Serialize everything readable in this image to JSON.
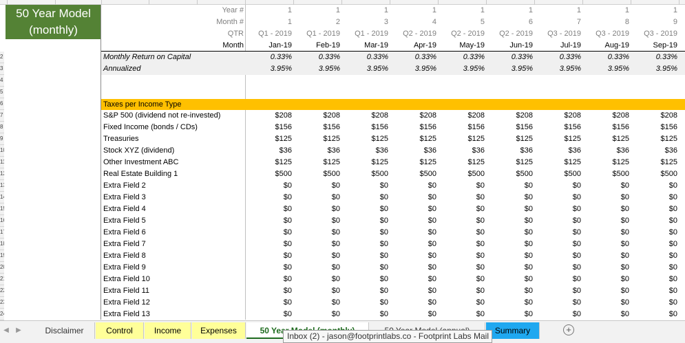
{
  "model_title": "50 Year Model (monthly)",
  "header_labels": {
    "year": "Year #",
    "month": "Month #",
    "qtr": "QTR",
    "month_name": "Month"
  },
  "columns": [
    {
      "year": "1",
      "month": "1",
      "qtr": "Q1 - 2019",
      "month_name": "Jan-19"
    },
    {
      "year": "1",
      "month": "2",
      "qtr": "Q1 - 2019",
      "month_name": "Feb-19"
    },
    {
      "year": "1",
      "month": "3",
      "qtr": "Q1 - 2019",
      "month_name": "Mar-19"
    },
    {
      "year": "1",
      "month": "4",
      "qtr": "Q2 - 2019",
      "month_name": "Apr-19"
    },
    {
      "year": "1",
      "month": "5",
      "qtr": "Q2 - 2019",
      "month_name": "May-19"
    },
    {
      "year": "1",
      "month": "6",
      "qtr": "Q2 - 2019",
      "month_name": "Jun-19"
    },
    {
      "year": "1",
      "month": "7",
      "qtr": "Q3 - 2019",
      "month_name": "Jul-19"
    },
    {
      "year": "1",
      "month": "8",
      "qtr": "Q3 - 2019",
      "month_name": "Aug-19"
    },
    {
      "year": "1",
      "month": "9",
      "qtr": "Q3 - 2019",
      "month_name": "Sep-19"
    }
  ],
  "returns": [
    {
      "label": "Monthly Return on Capital",
      "value": "0.33%"
    },
    {
      "label": "Annualized",
      "value": "3.95%"
    }
  ],
  "taxes_section": {
    "title": "Taxes per Income Type",
    "rows": [
      {
        "label": "S&P 500 (dividend not re-invested)",
        "value": "$208"
      },
      {
        "label": "Fixed Income (bonds / CDs)",
        "value": "$156"
      },
      {
        "label": "Treasuries",
        "value": "$125"
      },
      {
        "label": "Stock XYZ (dividend)",
        "value": "$36"
      },
      {
        "label": "Other Investment ABC",
        "value": "$125"
      },
      {
        "label": "Real Estate Building 1",
        "value": "$500"
      },
      {
        "label": "Extra Field 2",
        "value": "$0"
      },
      {
        "label": "Extra Field 3",
        "value": "$0"
      },
      {
        "label": "Extra Field 4",
        "value": "$0"
      },
      {
        "label": "Extra Field 5",
        "value": "$0"
      },
      {
        "label": "Extra Field 6",
        "value": "$0"
      },
      {
        "label": "Extra Field 7",
        "value": "$0"
      },
      {
        "label": "Extra Field 8",
        "value": "$0"
      },
      {
        "label": "Extra Field 9",
        "value": "$0"
      },
      {
        "label": "Extra Field 10",
        "value": "$0"
      },
      {
        "label": "Extra Field 11",
        "value": "$0"
      },
      {
        "label": "Extra Field 12",
        "value": "$0"
      },
      {
        "label": "Extra Field 13",
        "value": "$0"
      }
    ]
  },
  "row_numbers": [
    "2",
    "3",
    "4",
    "5",
    "6",
    "7",
    "8",
    "9",
    "10",
    "11",
    "12",
    "13",
    "14",
    "15",
    "16",
    "17",
    "18",
    "19",
    "20",
    "21",
    "22",
    "23",
    "24"
  ],
  "sheet_tabs": [
    {
      "label": "Disclaimer",
      "style": "plain"
    },
    {
      "label": "Control",
      "style": "yellow"
    },
    {
      "label": "Income",
      "style": "yellow"
    },
    {
      "label": "Expenses",
      "style": "yellow"
    },
    {
      "label": "50 Year Model (monthly)",
      "style": "active"
    },
    {
      "label": "50 Year Model (annual)",
      "style": "struck"
    },
    {
      "label": "Summary",
      "style": "blue"
    }
  ],
  "add_sheet_icon": "plus-circle-icon",
  "tooltip": "Inbox (2) - jason@footprintlabs.co - Footprint Labs Mail",
  "colors": {
    "title_bg": "#548235",
    "band_bg": "#ffc000",
    "active_tab_text": "#1e6b1e",
    "yellow_tab": "#ffff99",
    "blue_tab": "#1fa8f0"
  }
}
